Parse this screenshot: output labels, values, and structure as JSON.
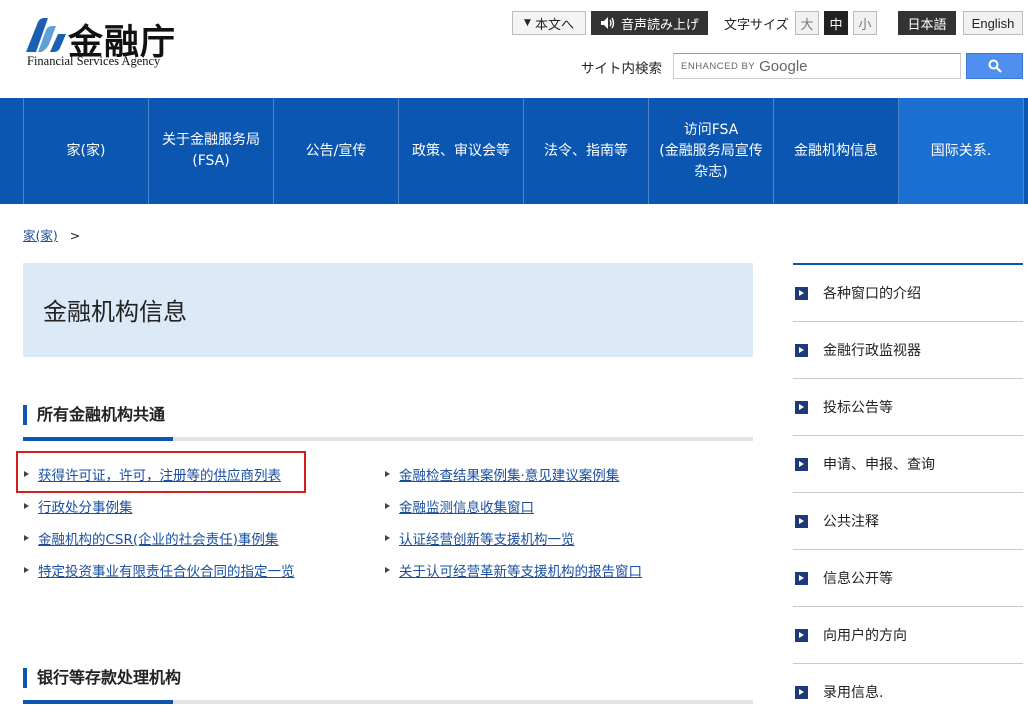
{
  "header": {
    "logo_kanji": "金融庁",
    "logo_english": "Financial Services Agency",
    "skip_label": "本文へ",
    "voice_label": "音声読み上げ",
    "font_size_label": "文字サイズ",
    "font_sizes": [
      "大",
      "中",
      "小"
    ],
    "font_size_selected": "中",
    "lang_ja": "日本語",
    "lang_en": "English",
    "search_label": "サイト内検索",
    "search_placeholder_enhanced": "ENHANCED BY",
    "search_placeholder_google": "Google",
    "brand_color": "#0a56b0"
  },
  "nav": {
    "items": [
      {
        "label": "家(家)"
      },
      {
        "label": "关于金融服务局\n(FSA)"
      },
      {
        "label": "公告/宣传"
      },
      {
        "label": "政策、审议会等"
      },
      {
        "label": "法令、指南等"
      },
      {
        "label": "访问FSA\n(金融服务局宣传\n杂志)"
      },
      {
        "label": "金融机构信息"
      },
      {
        "label": "国际关系."
      }
    ]
  },
  "breadcrumb": {
    "home": "家(家)",
    "separator": ">"
  },
  "page": {
    "title": "金融机构信息"
  },
  "section1": {
    "heading": "所有金融机构共通",
    "links_left": [
      "获得许可证，许可，注册等的供应商列表",
      "行政处分事例集",
      "金融机构的CSR(企业的社会责任)事例集",
      "特定投资事业有限责任合伙合同的指定一览"
    ],
    "links_right": [
      "金融检查结果案例集·意见建议案例集",
      "金融监测信息收集窗口",
      "认证经营创新等支援机构一览",
      "关于认可经营革新等支援机构的报告窗口"
    ]
  },
  "section2": {
    "heading": "银行等存款处理机构"
  },
  "sidebar": {
    "items": [
      "各种窗口的介绍",
      "金融行政监视器",
      "投标公告等",
      "申请、申报、查询",
      "公共注释",
      "信息公开等",
      "向用户的方向",
      "录用信息."
    ]
  }
}
